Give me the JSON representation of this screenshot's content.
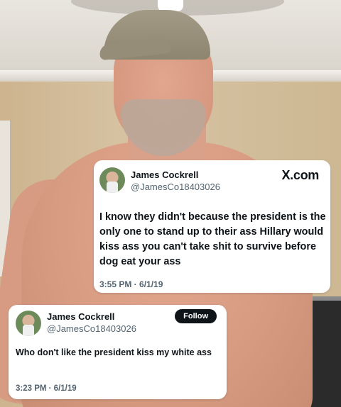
{
  "tweets": [
    {
      "author_name": "James Cockrell",
      "author_handle": "@JamesCo18403026",
      "brand": "X.com",
      "text": "I know they didn't because the president is the only one to stand up to their ass Hillary would kiss ass you  can't take shit  to  survive before  dog eat your ass",
      "timestamp": "3:55 PM · 6/1/19"
    },
    {
      "author_name": "James Cockrell",
      "author_handle": "@JamesCo18403026",
      "follow_label": "Follow",
      "text": "Who don't like the president kiss my white ass",
      "timestamp": "3:23 PM · 6/1/19"
    }
  ]
}
